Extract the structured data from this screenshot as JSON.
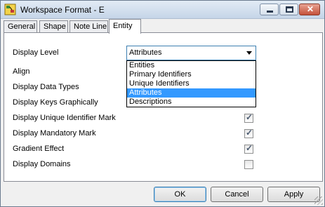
{
  "window": {
    "title": "Workspace Format - E"
  },
  "controls": {
    "close_glyph": "✕"
  },
  "tabs": [
    {
      "label": "General",
      "active": false
    },
    {
      "label": "Shape",
      "active": false
    },
    {
      "label": "Note Line",
      "active": false
    },
    {
      "label": "Entity",
      "active": true
    }
  ],
  "display_level": {
    "label": "Display Level",
    "selected": "Attributes",
    "options": [
      "Entities",
      "Primary Identifiers",
      "Unique Identifiers",
      "Attributes",
      "Descriptions"
    ]
  },
  "rows": [
    {
      "label": "Align"
    },
    {
      "label": "Display Data Types"
    },
    {
      "label": "Display Keys Graphically"
    },
    {
      "label": "Display Unique Identifier Mark",
      "checked": true
    },
    {
      "label": "Display Mandatory Mark",
      "checked": true
    },
    {
      "label": "Gradient Effect",
      "checked": true
    },
    {
      "label": "Display Domains",
      "checked": false
    }
  ],
  "buttons": {
    "ok": "OK",
    "cancel": "Cancel",
    "apply": "Apply"
  }
}
